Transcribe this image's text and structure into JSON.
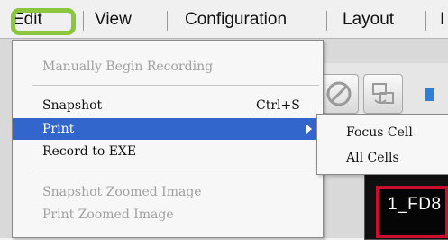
{
  "menubar": {
    "items": [
      {
        "label": "Edit"
      },
      {
        "label": "View"
      },
      {
        "label": "Configuration"
      },
      {
        "label": "Layout"
      },
      {
        "label": "I"
      }
    ]
  },
  "edit_menu": {
    "items": [
      {
        "label": "Manually Begin Recording",
        "shortcut": "",
        "enabled": false
      },
      {
        "label": "Snapshot",
        "shortcut": "Ctrl+S",
        "enabled": true
      },
      {
        "label": "Print",
        "shortcut": "",
        "enabled": true,
        "selected": true,
        "has_submenu": true
      },
      {
        "label": "Record to EXE",
        "shortcut": "",
        "enabled": true
      },
      {
        "label": "Snapshot Zoomed Image",
        "shortcut": "",
        "enabled": false
      },
      {
        "label": "Print Zoomed Image",
        "shortcut": "",
        "enabled": false
      }
    ]
  },
  "print_submenu": {
    "items": [
      {
        "label": "Focus Cell"
      },
      {
        "label": "All Cells"
      }
    ]
  },
  "video": {
    "cell_label": "1_FD8"
  },
  "colors": {
    "highlight_border": "#8cc63f",
    "selected_item": "#3366cc",
    "cell_border": "#c8102e"
  },
  "icons": [
    "stop-icon",
    "network-camera-icon",
    "play-icon",
    "submenu-arrow-icon"
  ]
}
